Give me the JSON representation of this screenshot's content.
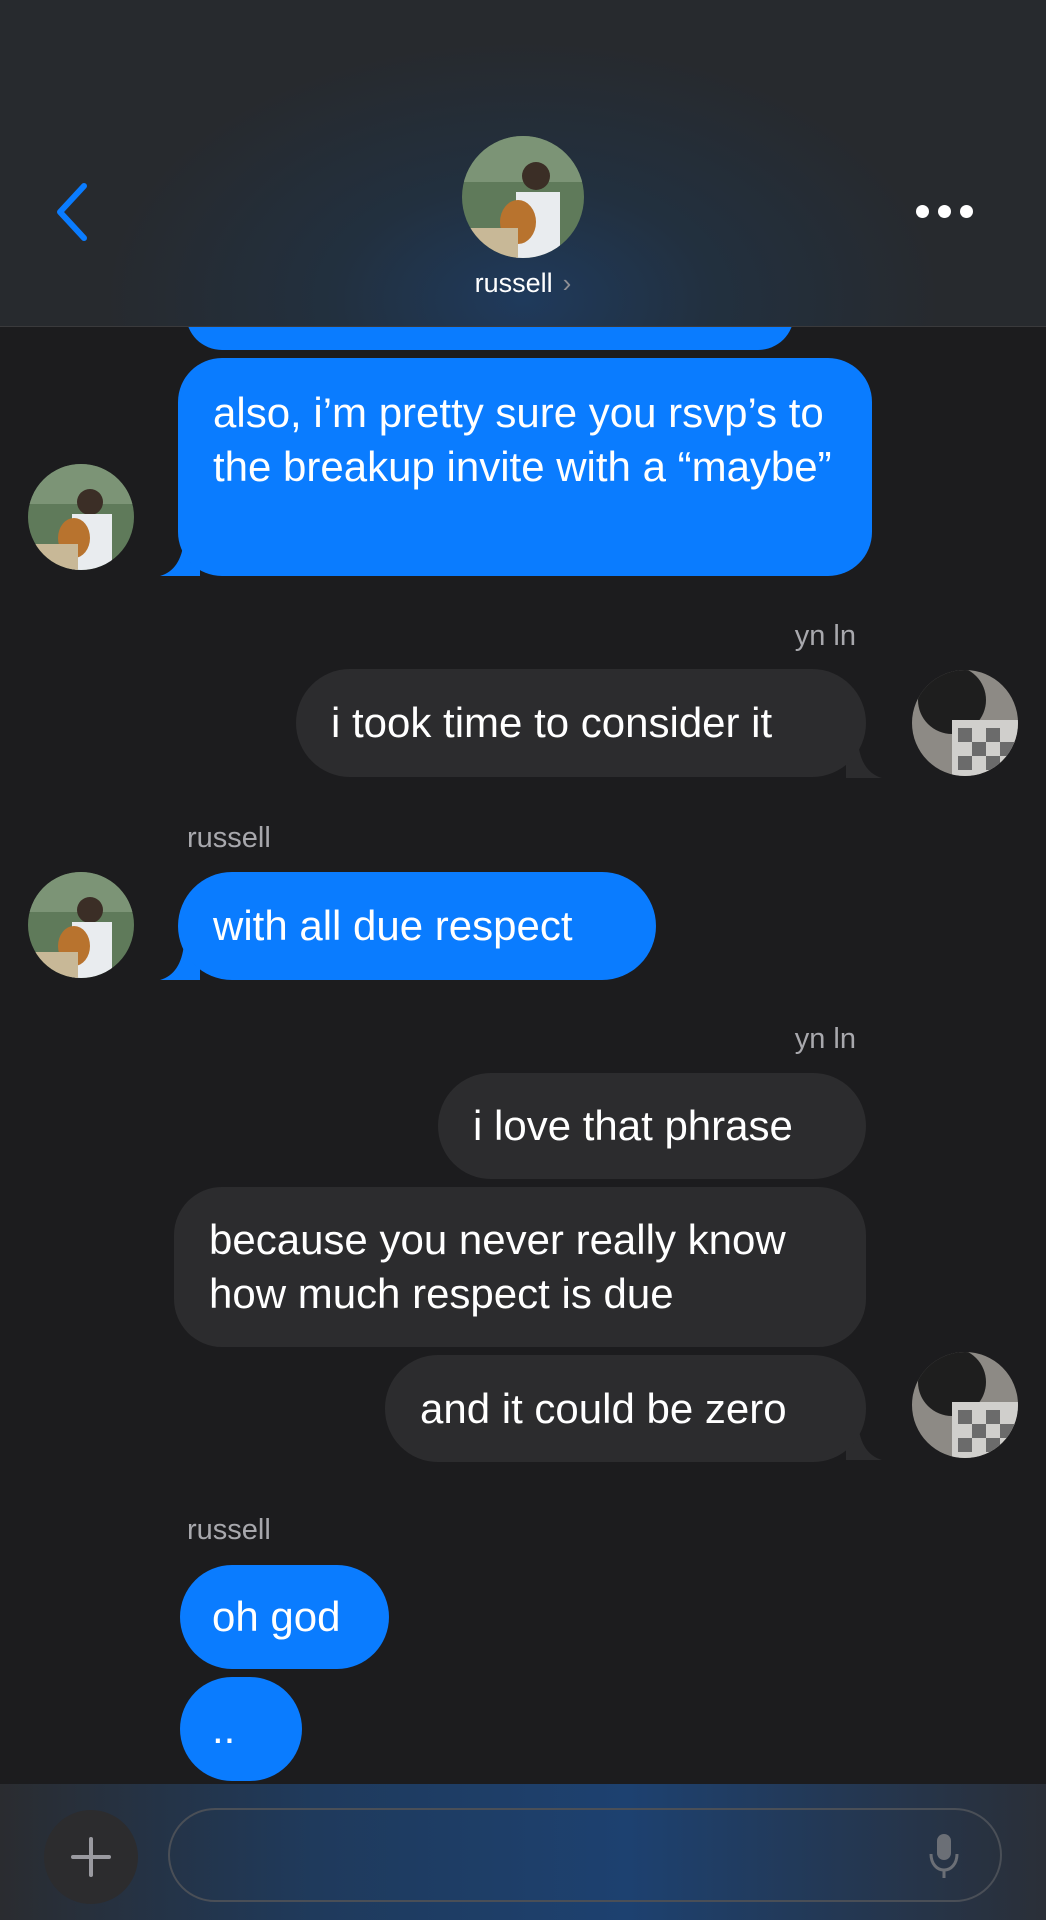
{
  "header": {
    "contact_name": "russell",
    "back_icon": "chevron-left-icon",
    "more_icon": "ellipsis-icon",
    "accent": "#0a7cff"
  },
  "messages": [
    {
      "from": "russell",
      "text": "also, i’m pretty sure you rsvp’s to the breakup invite with a “maybe”"
    },
    {
      "sender_label": "yn ln",
      "from": "me",
      "text": "i took time to consider it"
    },
    {
      "sender_label": "russell",
      "from": "russell",
      "text": "with all due respect"
    },
    {
      "sender_label": "yn ln",
      "from": "me",
      "text": "i love that phrase"
    },
    {
      "from": "me",
      "text": "because you never really know how much respect is due"
    },
    {
      "from": "me",
      "text": "and it could be zero"
    },
    {
      "sender_label": "russell",
      "from": "russell",
      "text": "oh god"
    },
    {
      "from": "russell",
      "text": ".."
    }
  ],
  "input_bar": {
    "add_icon": "plus-icon",
    "mic_icon": "microphone-icon",
    "placeholder": ""
  },
  "colors": {
    "incoming_bubble": "#0a7cff",
    "outgoing_bubble": "#2c2c2e",
    "background": "#1c1c1e"
  }
}
